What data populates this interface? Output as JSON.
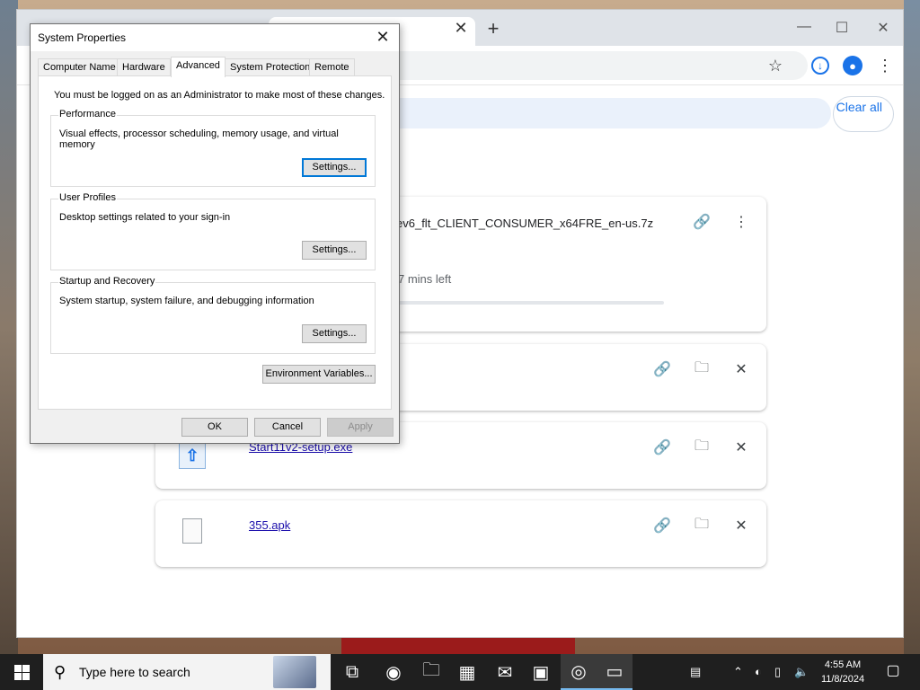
{
  "browser": {
    "clear_all_label": "Clear all",
    "downloads": [
      {
        "name": "ev6_flt_CLIENT_CONSUMER_x64FRE_en-us.7z",
        "status": "7 mins left",
        "progress": 0.0
      },
      {
        "name": "",
        "status": ""
      },
      {
        "name": "Start11v2-setup.exe",
        "status": ""
      },
      {
        "name": "355.apk",
        "status": ""
      }
    ],
    "icons": {
      "tab_close": "close-icon",
      "new_tab": "plus-icon",
      "bookmark": "star-icon",
      "download": "download-icon",
      "profile": "profile-icon",
      "menu": "more-vertical-icon"
    }
  },
  "dialog": {
    "title": "System Properties",
    "tabs": [
      "Computer Name",
      "Hardware",
      "Advanced",
      "System Protection",
      "Remote"
    ],
    "active_tab": "Advanced",
    "notice": "You must be logged on as an Administrator to make most of these changes.",
    "performance": {
      "label": "Performance",
      "desc": "Visual effects, processor scheduling, memory usage, and virtual memory",
      "button": "Settings..."
    },
    "user_profiles": {
      "label": "User Profiles",
      "desc": "Desktop settings related to your sign-in",
      "button": "Settings..."
    },
    "startup_recovery": {
      "label": "Startup and Recovery",
      "desc": "System startup, system failure, and debugging information",
      "button": "Settings..."
    },
    "env_button": "Environment Variables...",
    "ok": "OK",
    "cancel": "Cancel",
    "apply": "Apply"
  },
  "taskbar": {
    "search_placeholder": "Type here to search",
    "time": "4:55 AM",
    "date": "11/8/2024"
  },
  "colors": {
    "accent": "#1a73e8",
    "focus": "#0078d7",
    "taskbar": "#1f1f1f"
  }
}
